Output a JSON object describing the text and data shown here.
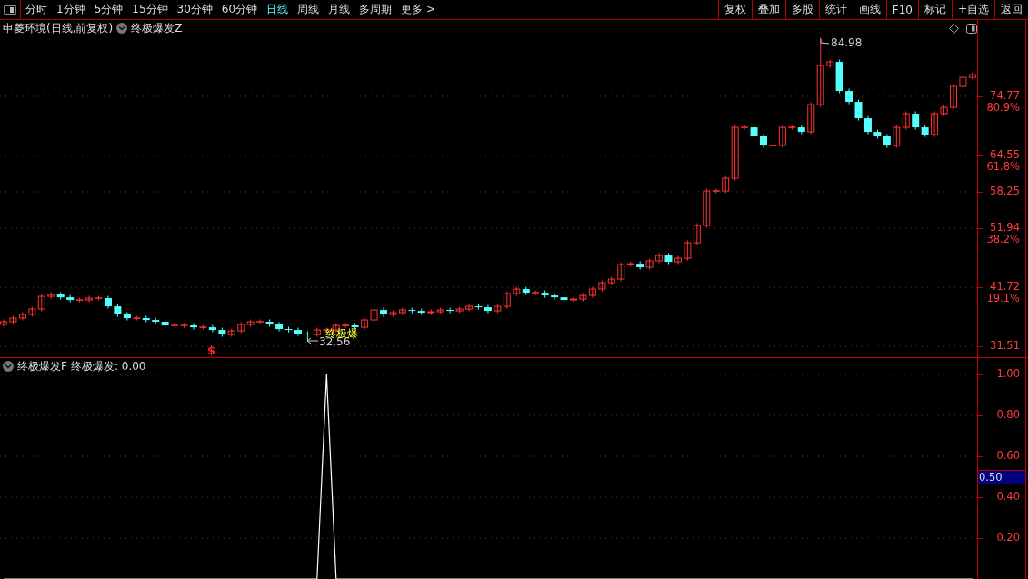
{
  "toolbar": {
    "periods": [
      {
        "label": "分时",
        "selected": false
      },
      {
        "label": "1分钟",
        "selected": false
      },
      {
        "label": "5分钟",
        "selected": false
      },
      {
        "label": "15分钟",
        "selected": false
      },
      {
        "label": "30分钟",
        "selected": false
      },
      {
        "label": "60分钟",
        "selected": false
      },
      {
        "label": "日线",
        "selected": true
      },
      {
        "label": "周线",
        "selected": false
      },
      {
        "label": "月线",
        "selected": false
      },
      {
        "label": "多周期",
        "selected": false
      },
      {
        "label": "更多 >",
        "selected": false
      }
    ],
    "buttons": [
      "复权",
      "叠加",
      "多股",
      "统计",
      "画线",
      "F10",
      "标记",
      "+自选",
      "返回"
    ]
  },
  "main_panel": {
    "title": "申菱环境(日线,前复权)",
    "indicator": "终极爆发Z",
    "percent_labels": [
      "80.9%",
      "61.8%",
      "38.2%",
      "19.1%"
    ],
    "high_label": "84.98",
    "low_label": "32.56",
    "signal_label": "终极爆",
    "buy_mark": "$",
    "chart_data": {
      "type": "candlestick",
      "ylim": [
        29.62,
        87.98
      ],
      "yticks": [
        {
          "value": 74.77,
          "label": "74.77"
        },
        {
          "value": 64.55,
          "label": "64.55"
        },
        {
          "value": 58.25,
          "label": "58.25"
        },
        {
          "value": 51.94,
          "label": "51.94"
        },
        {
          "value": 41.72,
          "label": "41.72"
        },
        {
          "value": 31.51,
          "label": "31.51"
        }
      ],
      "grid": true,
      "ohlc": [
        [
          35.3,
          36.15,
          34.9,
          35.75
        ],
        [
          35.75,
          36.78,
          35.35,
          36.38
        ],
        [
          36.38,
          37.41,
          35.98,
          37.01
        ],
        [
          37.01,
          38.35,
          36.61,
          37.95
        ],
        [
          37.95,
          40.55,
          37.55,
          40.15
        ],
        [
          40.15,
          40.87,
          39.75,
          40.47
        ],
        [
          40.47,
          40.87,
          39.59,
          39.99
        ],
        [
          39.99,
          40.39,
          39.12,
          39.52
        ],
        [
          39.52,
          39.92,
          39.12,
          39.52
        ],
        [
          39.52,
          40.24,
          39.12,
          39.84
        ],
        [
          39.84,
          40.24,
          39.44,
          39.84
        ],
        [
          39.84,
          40.24,
          38.02,
          38.42
        ],
        [
          38.42,
          38.82,
          36.61,
          37.01
        ],
        [
          37.01,
          37.41,
          35.98,
          36.38
        ],
        [
          36.38,
          36.78,
          35.98,
          36.38
        ],
        [
          36.38,
          36.78,
          35.66,
          36.06
        ],
        [
          36.06,
          36.46,
          35.35,
          35.75
        ],
        [
          35.75,
          36.15,
          34.72,
          35.12
        ],
        [
          35.12,
          35.52,
          34.72,
          35.12
        ],
        [
          35.12,
          35.52,
          34.72,
          35.12
        ],
        [
          35.12,
          35.52,
          34.4,
          34.8
        ],
        [
          34.8,
          35.2,
          34.4,
          34.8
        ],
        [
          34.8,
          35.2,
          33.93,
          34.33
        ],
        [
          34.33,
          34.73,
          33.14,
          33.54
        ],
        [
          33.54,
          34.57,
          33.14,
          34.17
        ],
        [
          34.17,
          35.68,
          33.77,
          35.28
        ],
        [
          35.28,
          36.15,
          34.88,
          35.75
        ],
        [
          35.75,
          36.15,
          35.35,
          35.75
        ],
        [
          35.75,
          36.15,
          34.88,
          35.28
        ],
        [
          35.28,
          35.68,
          34.09,
          34.49
        ],
        [
          34.49,
          34.89,
          33.93,
          34.33
        ],
        [
          34.33,
          34.73,
          33.3,
          33.7
        ],
        [
          33.7,
          34.1,
          32.56,
          33.54
        ],
        [
          33.54,
          34.73,
          33.14,
          34.33
        ],
        [
          34.33,
          34.73,
          33.93,
          34.33
        ],
        [
          34.33,
          35.52,
          33.93,
          35.12
        ],
        [
          35.12,
          35.52,
          34.72,
          35.12
        ],
        [
          35.12,
          35.52,
          34.4,
          34.8
        ],
        [
          34.8,
          36.46,
          34.4,
          36.06
        ],
        [
          36.06,
          38.19,
          35.66,
          37.79
        ],
        [
          37.79,
          38.19,
          36.61,
          37.01
        ],
        [
          37.01,
          37.72,
          36.61,
          37.32
        ],
        [
          37.32,
          38.19,
          36.92,
          37.79
        ],
        [
          37.79,
          38.19,
          37.23,
          37.63
        ],
        [
          37.63,
          38.03,
          36.92,
          37.32
        ],
        [
          37.32,
          37.88,
          36.92,
          37.48
        ],
        [
          37.48,
          38.19,
          37.08,
          37.79
        ],
        [
          37.79,
          38.19,
          37.23,
          37.63
        ],
        [
          37.63,
          38.35,
          37.23,
          37.95
        ],
        [
          37.95,
          38.82,
          37.55,
          38.42
        ],
        [
          38.42,
          38.82,
          37.86,
          38.26
        ],
        [
          38.26,
          38.66,
          37.23,
          37.63
        ],
        [
          37.63,
          38.82,
          37.23,
          38.42
        ],
        [
          38.42,
          41.02,
          38.02,
          40.62
        ],
        [
          40.62,
          41.81,
          40.22,
          41.41
        ],
        [
          41.41,
          41.81,
          40.38,
          40.78
        ],
        [
          40.78,
          41.18,
          40.38,
          40.78
        ],
        [
          40.78,
          41.18,
          39.91,
          40.31
        ],
        [
          40.31,
          40.71,
          39.59,
          39.99
        ],
        [
          39.99,
          40.39,
          39.12,
          39.52
        ],
        [
          39.52,
          40.08,
          39.12,
          39.68
        ],
        [
          39.68,
          40.71,
          39.28,
          40.31
        ],
        [
          40.31,
          41.81,
          39.91,
          41.41
        ],
        [
          41.41,
          42.91,
          41.01,
          42.51
        ],
        [
          42.51,
          43.54,
          42.11,
          43.14
        ],
        [
          43.14,
          46.06,
          42.74,
          45.66
        ],
        [
          45.66,
          46.21,
          45.26,
          45.81
        ],
        [
          45.81,
          46.21,
          44.79,
          45.19
        ],
        [
          45.19,
          46.69,
          44.79,
          46.29
        ],
        [
          46.29,
          47.63,
          45.89,
          47.23
        ],
        [
          47.23,
          47.63,
          45.73,
          46.13
        ],
        [
          46.13,
          47.16,
          45.73,
          46.76
        ],
        [
          46.76,
          49.83,
          46.36,
          49.43
        ],
        [
          49.43,
          52.82,
          49.03,
          52.42
        ],
        [
          52.42,
          58.8,
          52.02,
          58.4
        ],
        [
          58.4,
          58.8,
          58.0,
          58.4
        ],
        [
          58.4,
          61.0,
          58.0,
          60.6
        ],
        [
          60.6,
          69.81,
          60.2,
          69.41
        ],
        [
          69.41,
          69.81,
          69.01,
          69.41
        ],
        [
          69.41,
          69.81,
          67.44,
          67.84
        ],
        [
          67.84,
          68.24,
          65.86,
          66.26
        ],
        [
          66.26,
          66.66,
          65.86,
          66.26
        ],
        [
          66.26,
          69.81,
          65.86,
          69.41
        ],
        [
          69.41,
          69.81,
          69.01,
          69.41
        ],
        [
          69.41,
          69.81,
          68.22,
          68.62
        ],
        [
          68.62,
          73.74,
          68.22,
          73.34
        ],
        [
          73.34,
          84.98,
          72.94,
          80.11
        ],
        [
          80.11,
          81.13,
          79.71,
          80.73
        ],
        [
          80.73,
          81.13,
          75.3,
          75.7
        ],
        [
          75.7,
          76.1,
          73.41,
          73.81
        ],
        [
          73.81,
          74.21,
          70.58,
          70.98
        ],
        [
          70.98,
          71.38,
          68.22,
          68.62
        ],
        [
          68.62,
          69.02,
          67.44,
          67.84
        ],
        [
          67.84,
          68.24,
          65.86,
          66.26
        ],
        [
          66.26,
          69.81,
          65.86,
          69.41
        ],
        [
          69.41,
          72.17,
          69.01,
          71.77
        ],
        [
          71.77,
          72.17,
          69.01,
          69.41
        ],
        [
          69.41,
          69.81,
          67.75,
          68.15
        ],
        [
          68.15,
          72.17,
          67.75,
          71.77
        ],
        [
          71.77,
          73.27,
          71.37,
          72.87
        ],
        [
          72.87,
          76.89,
          72.47,
          76.49
        ],
        [
          76.49,
          78.46,
          76.09,
          78.06
        ],
        [
          78.06,
          78.93,
          77.66,
          78.53
        ]
      ]
    }
  },
  "lower_panel": {
    "indicator": "终极爆发F",
    "reading": "终极爆发: 0.00",
    "marker": "0.50",
    "chart_data": {
      "type": "line",
      "ylim": [
        0,
        1
      ],
      "grid": true,
      "yticks": [
        {
          "value": 0.2,
          "label": "0.20"
        },
        {
          "value": 0.4,
          "label": "0.40"
        },
        {
          "value": 0.6,
          "label": "0.60"
        },
        {
          "value": 0.8,
          "label": "0.80"
        },
        {
          "value": 1,
          "label": "1.00"
        }
      ],
      "series": [
        {
          "color": "#ffffff",
          "values": [
            0,
            0,
            0,
            0,
            0,
            0,
            0,
            0,
            0,
            0,
            0,
            0,
            0,
            0,
            0,
            0,
            0,
            0,
            0,
            0,
            0,
            0,
            0,
            0,
            0,
            0,
            0,
            0,
            0,
            0,
            0,
            0,
            0,
            0,
            1,
            0,
            0,
            0,
            0,
            0,
            0,
            0,
            0,
            0,
            0,
            0,
            0,
            0,
            0,
            0,
            0,
            0,
            0,
            0,
            0,
            0,
            0,
            0,
            0,
            0,
            0,
            0,
            0,
            0,
            0,
            0,
            0,
            0,
            0,
            0,
            0,
            0,
            0,
            0,
            0,
            0,
            0,
            0,
            0,
            0,
            0,
            0,
            0,
            0,
            0,
            0,
            0,
            0,
            0,
            0,
            0,
            0,
            0,
            0,
            0,
            0,
            0,
            0,
            0,
            0,
            0,
            0,
            0
          ]
        }
      ]
    }
  }
}
